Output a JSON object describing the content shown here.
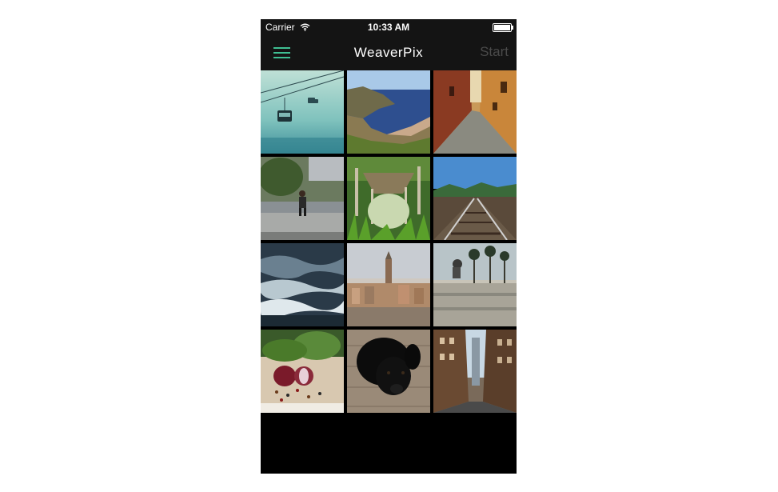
{
  "status_bar": {
    "carrier": "Carrier",
    "time": "10:33 AM"
  },
  "nav_bar": {
    "title": "WeaverPix",
    "start_label": "Start",
    "menu_icon": "hamburger-menu-icon",
    "accent_color": "#3fbf93"
  },
  "photos": [
    {
      "subject": "cable-car"
    },
    {
      "subject": "coastline-bay"
    },
    {
      "subject": "old-street-alley"
    },
    {
      "subject": "person-sitting-river"
    },
    {
      "subject": "wooden-pier-grass"
    },
    {
      "subject": "railway-tracks"
    },
    {
      "subject": "ocean-waves"
    },
    {
      "subject": "city-skyline"
    },
    {
      "subject": "skater-palm-trees"
    },
    {
      "subject": "onion-peppercorns"
    },
    {
      "subject": "black-dog"
    },
    {
      "subject": "city-street-buildings"
    }
  ]
}
